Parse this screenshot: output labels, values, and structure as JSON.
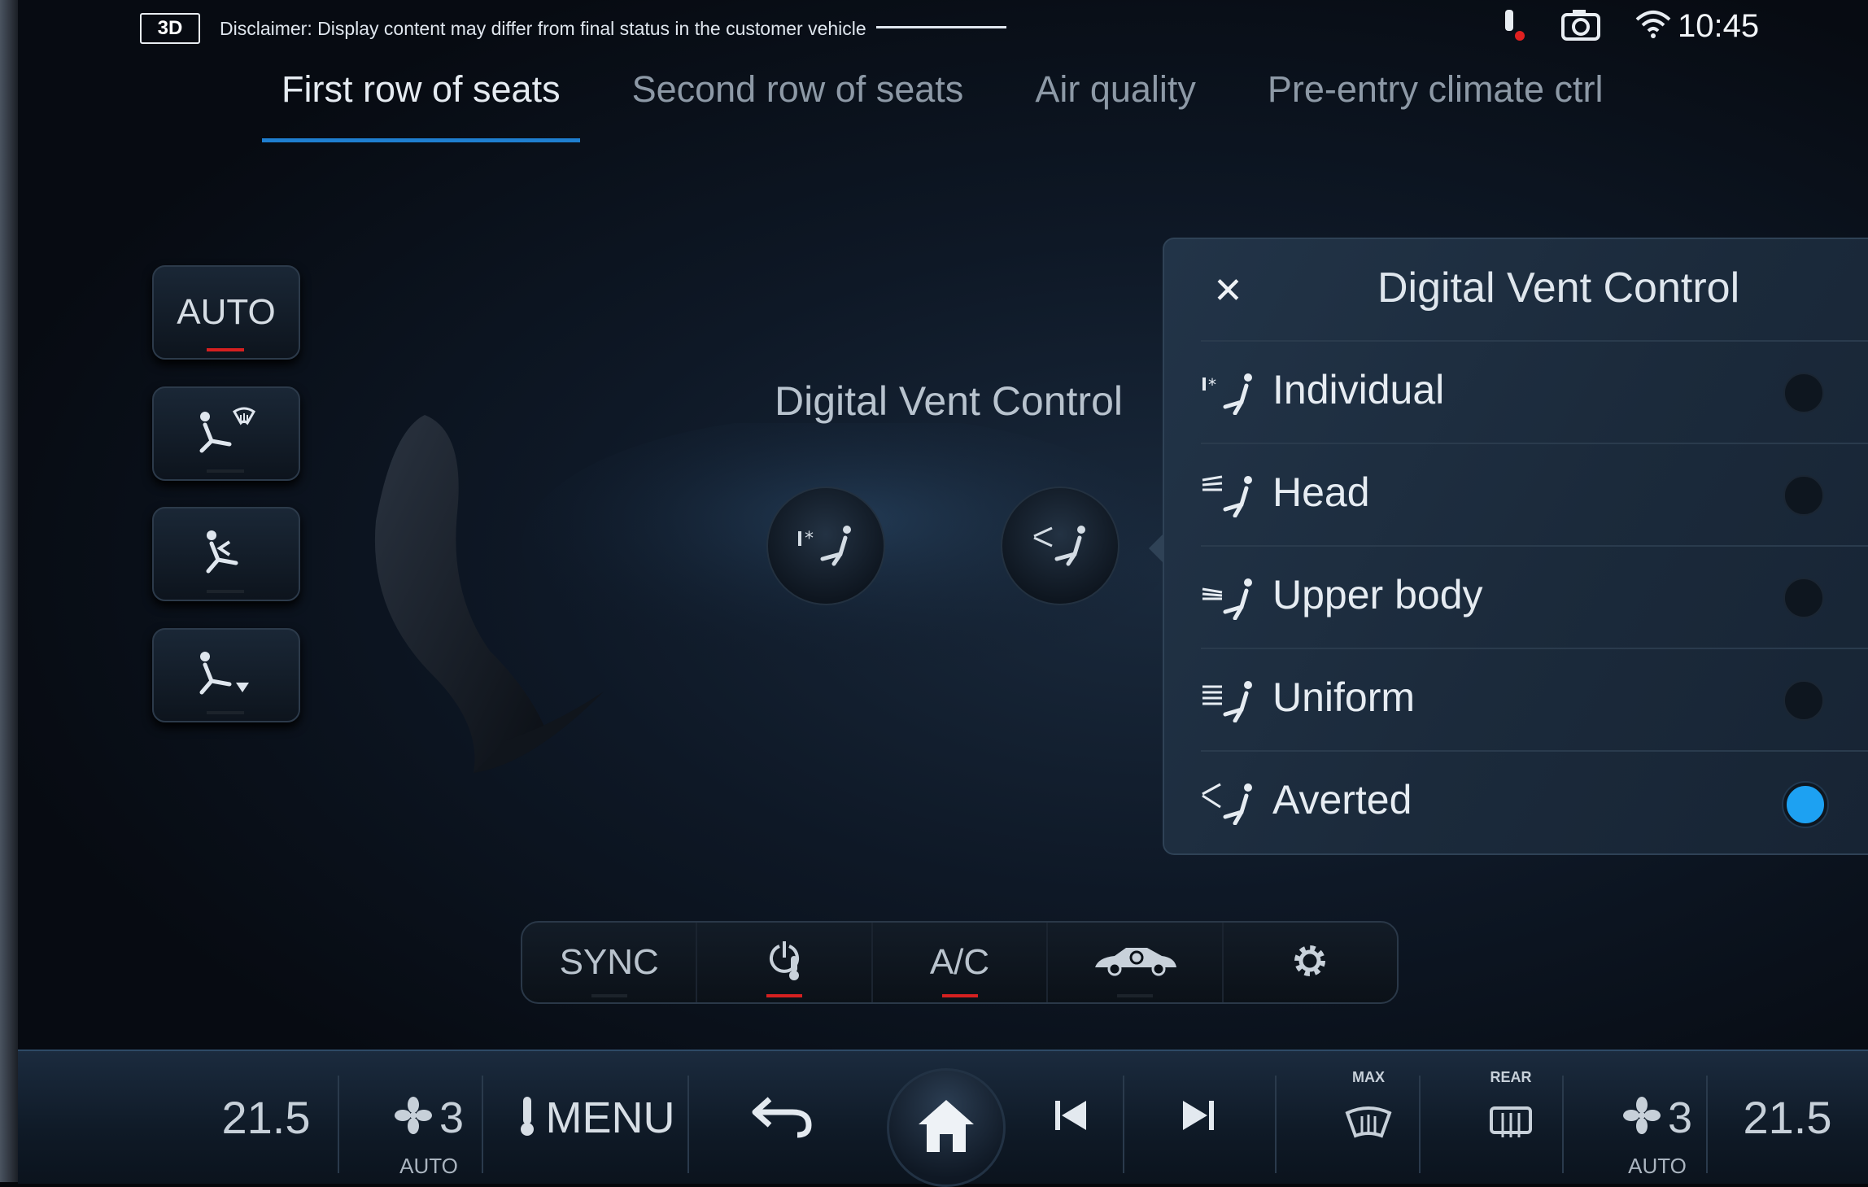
{
  "status_bar": {
    "badge": "3D",
    "disclaimer": "Disclaimer: Display content may differ from final status in the customer vehicle",
    "time": "10:45"
  },
  "tabs": [
    {
      "label": "First row of seats",
      "active": true
    },
    {
      "label": "Second row of seats",
      "active": false
    },
    {
      "label": "Air quality",
      "active": false
    },
    {
      "label": "Pre-entry climate ctrl",
      "active": false
    }
  ],
  "modes": {
    "auto_label": "AUTO"
  },
  "main": {
    "title": "Digital Vent Control"
  },
  "panel": {
    "title": "Digital Vent Control",
    "options": [
      {
        "label": "Individual",
        "selected": false
      },
      {
        "label": "Head",
        "selected": false
      },
      {
        "label": "Upper body",
        "selected": false
      },
      {
        "label": "Uniform",
        "selected": false
      },
      {
        "label": "Averted",
        "selected": true
      }
    ]
  },
  "quickbar": {
    "sync": "SYNC",
    "ac": "A/C"
  },
  "bottom": {
    "left_temp": "21.5",
    "left_fan": "3",
    "left_fan_mode": "AUTO",
    "menu": "MENU",
    "max_label": "MAX",
    "rear_label": "REAR",
    "right_fan": "3",
    "right_fan_mode": "AUTO",
    "right_temp": "21.5"
  },
  "colors": {
    "accent": "#1f7fd0",
    "selected_radio": "#1da1f2",
    "indicator_red": "#d52020"
  }
}
